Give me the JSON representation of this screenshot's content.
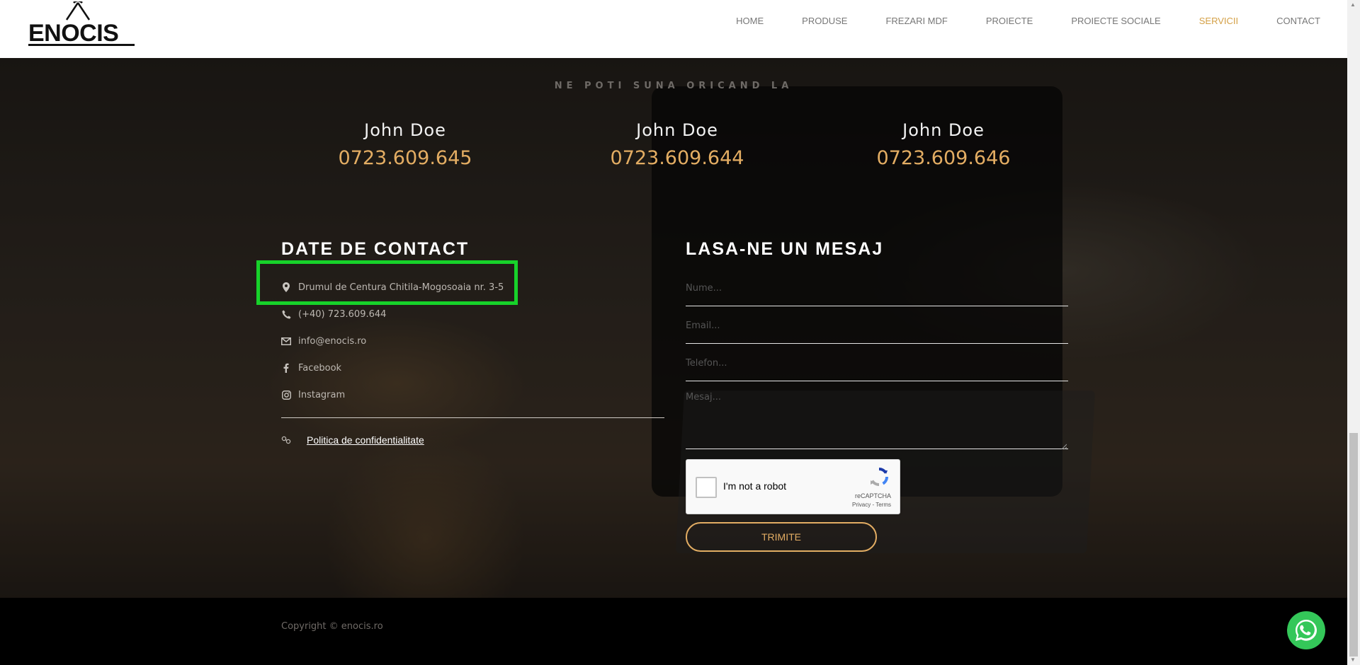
{
  "brand": {
    "logo_text": "ENOCIS"
  },
  "nav": {
    "items": [
      {
        "label": "HOME"
      },
      {
        "label": "PRODUSE"
      },
      {
        "label": "FREZARI MDF"
      },
      {
        "label": "PROIECTE"
      },
      {
        "label": "PROIECTE SOCIALE"
      },
      {
        "label": "SERVICII",
        "active": true
      },
      {
        "label": "CONTACT"
      }
    ],
    "active_color": "#d4a046"
  },
  "tagline": "NE POTI SUNA ORICAND LA",
  "contacts": [
    {
      "name": "John Doe",
      "phone": "0723.609.645"
    },
    {
      "name": "John Doe",
      "phone": "0723.609.644"
    },
    {
      "name": "John Doe",
      "phone": "0723.609.646"
    }
  ],
  "contact_info": {
    "title": "DATE DE CONTACT",
    "address": "Drumul de Centura Chitila-Mogosoaia nr. 3-5",
    "phone": "(+40) 723.609.644",
    "email": "info@enocis.ro",
    "facebook": "Facebook",
    "instagram": "Instagram",
    "policy": "Politica de confidentialitate"
  },
  "message_form": {
    "title": "LASA-NE UN MESAJ",
    "name_placeholder": "Nume...",
    "email_placeholder": "Email...",
    "phone_placeholder": "Telefon...",
    "message_placeholder": "Mesaj...",
    "captcha_label": "I'm not a robot",
    "captcha_brand": "reCAPTCHA",
    "captcha_links": "Privacy - Terms",
    "submit_label": "TRIMITE"
  },
  "footer": {
    "copyright": "Copyright © enocis.ro"
  },
  "colors": {
    "accent": "#e3ad63",
    "highlight": "#17d22a",
    "whatsapp": "#34c759"
  },
  "icons": [
    "map-marker-icon",
    "phone-icon",
    "envelope-icon",
    "facebook-icon",
    "instagram-icon",
    "link-icon",
    "recaptcha-icon",
    "whatsapp-icon"
  ]
}
